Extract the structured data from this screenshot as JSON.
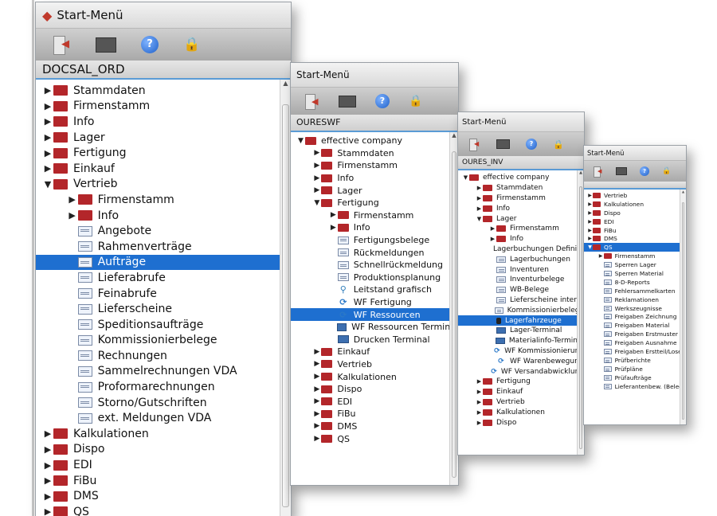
{
  "windows": [
    {
      "title": "Start-Menü",
      "path": "DOCSAL_ORD",
      "items": [
        {
          "label": "Stammdaten",
          "type": "folder",
          "level": 0,
          "expanded": false,
          "selected": false
        },
        {
          "label": "Firmenstamm",
          "type": "folder",
          "level": 0,
          "expanded": false,
          "selected": false
        },
        {
          "label": "Info",
          "type": "folder",
          "level": 0,
          "expanded": false,
          "selected": false
        },
        {
          "label": "Lager",
          "type": "folder",
          "level": 0,
          "expanded": false,
          "selected": false
        },
        {
          "label": "Fertigung",
          "type": "folder",
          "level": 0,
          "expanded": false,
          "selected": false
        },
        {
          "label": "Einkauf",
          "type": "folder",
          "level": 0,
          "expanded": false,
          "selected": false
        },
        {
          "label": "Vertrieb",
          "type": "folder",
          "level": 0,
          "expanded": true,
          "selected": false
        },
        {
          "label": "Firmenstamm",
          "type": "folder",
          "level": 1,
          "expanded": false,
          "selected": false
        },
        {
          "label": "Info",
          "type": "folder",
          "level": 1,
          "expanded": false,
          "selected": false
        },
        {
          "label": "Angebote",
          "type": "doc",
          "level": 1,
          "selected": false
        },
        {
          "label": "Rahmenverträge",
          "type": "doc",
          "level": 1,
          "selected": false
        },
        {
          "label": "Aufträge",
          "type": "doc",
          "level": 1,
          "selected": true
        },
        {
          "label": "Lieferabrufe",
          "type": "doc",
          "level": 1,
          "selected": false
        },
        {
          "label": "Feinabrufe",
          "type": "doc",
          "level": 1,
          "selected": false
        },
        {
          "label": "Lieferscheine",
          "type": "doc",
          "level": 1,
          "selected": false
        },
        {
          "label": "Speditionsaufträge",
          "type": "doc",
          "level": 1,
          "selected": false
        },
        {
          "label": "Kommissionierbelege",
          "type": "doc",
          "level": 1,
          "selected": false
        },
        {
          "label": "Rechnungen",
          "type": "doc",
          "level": 1,
          "selected": false
        },
        {
          "label": "Sammelrechnungen VDA",
          "type": "doc",
          "level": 1,
          "selected": false
        },
        {
          "label": "Proformarechnungen",
          "type": "doc",
          "level": 1,
          "selected": false
        },
        {
          "label": "Storno/Gutschriften",
          "type": "doc",
          "level": 1,
          "selected": false
        },
        {
          "label": "ext. Meldungen VDA",
          "type": "doc",
          "level": 1,
          "selected": false
        },
        {
          "label": "Kalkulationen",
          "type": "folder",
          "level": 0,
          "expanded": false,
          "selected": false
        },
        {
          "label": "Dispo",
          "type": "folder",
          "level": 0,
          "expanded": false,
          "selected": false
        },
        {
          "label": "EDI",
          "type": "folder",
          "level": 0,
          "expanded": false,
          "selected": false
        },
        {
          "label": "FiBu",
          "type": "folder",
          "level": 0,
          "expanded": false,
          "selected": false
        },
        {
          "label": "DMS",
          "type": "folder",
          "level": 0,
          "expanded": false,
          "selected": false
        },
        {
          "label": "QS",
          "type": "folder",
          "level": 0,
          "expanded": false,
          "selected": false
        }
      ]
    },
    {
      "title": "Start-Menü",
      "path": "OURESWF",
      "items": [
        {
          "label": "effective company",
          "type": "folder",
          "level": 0,
          "expanded": true,
          "selected": false
        },
        {
          "label": "Stammdaten",
          "type": "folder",
          "level": 1,
          "expanded": false,
          "selected": false
        },
        {
          "label": "Firmenstamm",
          "type": "folder",
          "level": 1,
          "expanded": false,
          "selected": false
        },
        {
          "label": "Info",
          "type": "folder",
          "level": 1,
          "expanded": false,
          "selected": false
        },
        {
          "label": "Lager",
          "type": "folder",
          "level": 1,
          "expanded": false,
          "selected": false
        },
        {
          "label": "Fertigung",
          "type": "folder",
          "level": 1,
          "expanded": true,
          "selected": false
        },
        {
          "label": "Firmenstamm",
          "type": "folder",
          "level": 2,
          "expanded": false,
          "selected": false
        },
        {
          "label": "Info",
          "type": "folder",
          "level": 2,
          "expanded": false,
          "selected": false
        },
        {
          "label": "Fertigungsbelege",
          "type": "doc",
          "level": 2,
          "selected": false
        },
        {
          "label": "Rückmeldungen",
          "type": "doc",
          "level": 2,
          "selected": false
        },
        {
          "label": "Schnellrückmeldung",
          "type": "doc",
          "level": 2,
          "selected": false
        },
        {
          "label": "Produktionsplanung",
          "type": "doc",
          "level": 2,
          "selected": false
        },
        {
          "label": "Leitstand grafisch",
          "type": "pin",
          "level": 2,
          "selected": false
        },
        {
          "label": "WF Fertigung",
          "type": "wf",
          "level": 2,
          "selected": false
        },
        {
          "label": "WF Ressourcen",
          "type": "wf",
          "level": 2,
          "selected": true
        },
        {
          "label": "WF Ressourcen Terminal",
          "type": "term",
          "level": 2,
          "selected": false
        },
        {
          "label": "Drucken Terminal",
          "type": "term",
          "level": 2,
          "selected": false
        },
        {
          "label": "Einkauf",
          "type": "folder",
          "level": 1,
          "expanded": false,
          "selected": false
        },
        {
          "label": "Vertrieb",
          "type": "folder",
          "level": 1,
          "expanded": false,
          "selected": false
        },
        {
          "label": "Kalkulationen",
          "type": "folder",
          "level": 1,
          "expanded": false,
          "selected": false
        },
        {
          "label": "Dispo",
          "type": "folder",
          "level": 1,
          "expanded": false,
          "selected": false
        },
        {
          "label": "EDI",
          "type": "folder",
          "level": 1,
          "expanded": false,
          "selected": false
        },
        {
          "label": "FiBu",
          "type": "folder",
          "level": 1,
          "expanded": false,
          "selected": false
        },
        {
          "label": "DMS",
          "type": "folder",
          "level": 1,
          "expanded": false,
          "selected": false
        },
        {
          "label": "QS",
          "type": "folder",
          "level": 1,
          "expanded": false,
          "selected": false
        }
      ]
    },
    {
      "title": "Start-Menü",
      "path": "OURES_INV",
      "items": [
        {
          "label": "effective company",
          "type": "folder",
          "level": 0,
          "expanded": true,
          "selected": false
        },
        {
          "label": "Stammdaten",
          "type": "folder",
          "level": 1,
          "expanded": false,
          "selected": false
        },
        {
          "label": "Firmenstamm",
          "type": "folder",
          "level": 1,
          "expanded": false,
          "selected": false
        },
        {
          "label": "Info",
          "type": "folder",
          "level": 1,
          "expanded": false,
          "selected": false
        },
        {
          "label": "Lager",
          "type": "folder",
          "level": 1,
          "expanded": true,
          "selected": false
        },
        {
          "label": "Firmenstamm",
          "type": "folder",
          "level": 2,
          "expanded": false,
          "selected": false
        },
        {
          "label": "Info",
          "type": "folder",
          "level": 2,
          "expanded": false,
          "selected": false
        },
        {
          "label": "Lagerbuchungen Definition",
          "type": "dev",
          "level": 2,
          "selected": false
        },
        {
          "label": "Lagerbuchungen",
          "type": "doc",
          "level": 2,
          "selected": false
        },
        {
          "label": "Inventuren",
          "type": "doc",
          "level": 2,
          "selected": false
        },
        {
          "label": "Inventurbelege",
          "type": "doc",
          "level": 2,
          "selected": false
        },
        {
          "label": "WB-Belege",
          "type": "doc",
          "level": 2,
          "selected": false
        },
        {
          "label": "Lieferscheine intern",
          "type": "doc",
          "level": 2,
          "selected": false
        },
        {
          "label": "Kommissionierbelege",
          "type": "doc",
          "level": 2,
          "selected": false
        },
        {
          "label": "Lagerfahrzeuge",
          "type": "dev",
          "level": 2,
          "selected": true
        },
        {
          "label": "Lager-Terminal",
          "type": "term",
          "level": 2,
          "selected": false
        },
        {
          "label": "Materialinfo-Terminal",
          "type": "term",
          "level": 2,
          "selected": false
        },
        {
          "label": "WF Kommissionierung",
          "type": "wf",
          "level": 2,
          "selected": false
        },
        {
          "label": "WF Warenbewegung",
          "type": "wf",
          "level": 2,
          "selected": false
        },
        {
          "label": "WF Versandabwicklung",
          "type": "wf",
          "level": 2,
          "selected": false
        },
        {
          "label": "Fertigung",
          "type": "folder",
          "level": 1,
          "expanded": false,
          "selected": false
        },
        {
          "label": "Einkauf",
          "type": "folder",
          "level": 1,
          "expanded": false,
          "selected": false
        },
        {
          "label": "Vertrieb",
          "type": "folder",
          "level": 1,
          "expanded": false,
          "selected": false
        },
        {
          "label": "Kalkulationen",
          "type": "folder",
          "level": 1,
          "expanded": false,
          "selected": false
        },
        {
          "label": "Dispo",
          "type": "folder",
          "level": 1,
          "expanded": false,
          "selected": false
        }
      ]
    },
    {
      "title": "Start-Menü",
      "path": "",
      "items": [
        {
          "label": "Vertrieb",
          "type": "folder",
          "level": 0,
          "expanded": false,
          "selected": false
        },
        {
          "label": "Kalkulationen",
          "type": "folder",
          "level": 0,
          "expanded": false,
          "selected": false
        },
        {
          "label": "Dispo",
          "type": "folder",
          "level": 0,
          "expanded": false,
          "selected": false
        },
        {
          "label": "EDI",
          "type": "folder",
          "level": 0,
          "expanded": false,
          "selected": false
        },
        {
          "label": "FiBu",
          "type": "folder",
          "level": 0,
          "expanded": false,
          "selected": false
        },
        {
          "label": "DMS",
          "type": "folder",
          "level": 0,
          "expanded": false,
          "selected": false
        },
        {
          "label": "QS",
          "type": "folder",
          "level": 0,
          "expanded": true,
          "selected": true
        },
        {
          "label": "Firmenstamm",
          "type": "folder",
          "level": 1,
          "expanded": false,
          "selected": false
        },
        {
          "label": "Sperren Lager",
          "type": "doc",
          "level": 1,
          "selected": false
        },
        {
          "label": "Sperren Material",
          "type": "doc",
          "level": 1,
          "selected": false
        },
        {
          "label": "8-D-Reports",
          "type": "doc",
          "level": 1,
          "selected": false
        },
        {
          "label": "Fehlersammelkarten",
          "type": "doc",
          "level": 1,
          "selected": false
        },
        {
          "label": "Reklamationen",
          "type": "doc",
          "level": 1,
          "selected": false
        },
        {
          "label": "Werkszeugnisse",
          "type": "doc",
          "level": 1,
          "selected": false
        },
        {
          "label": "Freigaben Zeichnung",
          "type": "doc",
          "level": 1,
          "selected": false
        },
        {
          "label": "Freigaben Material",
          "type": "doc",
          "level": 1,
          "selected": false
        },
        {
          "label": "Freigaben Erstmuster",
          "type": "doc",
          "level": 1,
          "selected": false
        },
        {
          "label": "Freigaben Ausnahme",
          "type": "doc",
          "level": 1,
          "selected": false
        },
        {
          "label": "Freigaben Erstteil/Lose",
          "type": "doc",
          "level": 1,
          "selected": false
        },
        {
          "label": "Prüfberichte",
          "type": "doc",
          "level": 1,
          "selected": false
        },
        {
          "label": "Prüfpläne",
          "type": "doc",
          "level": 1,
          "selected": false
        },
        {
          "label": "Prüfaufträge",
          "type": "doc",
          "level": 1,
          "selected": false
        },
        {
          "label": "Lieferantenbew. (Beleg)",
          "type": "doc",
          "level": 1,
          "selected": false
        }
      ]
    }
  ]
}
